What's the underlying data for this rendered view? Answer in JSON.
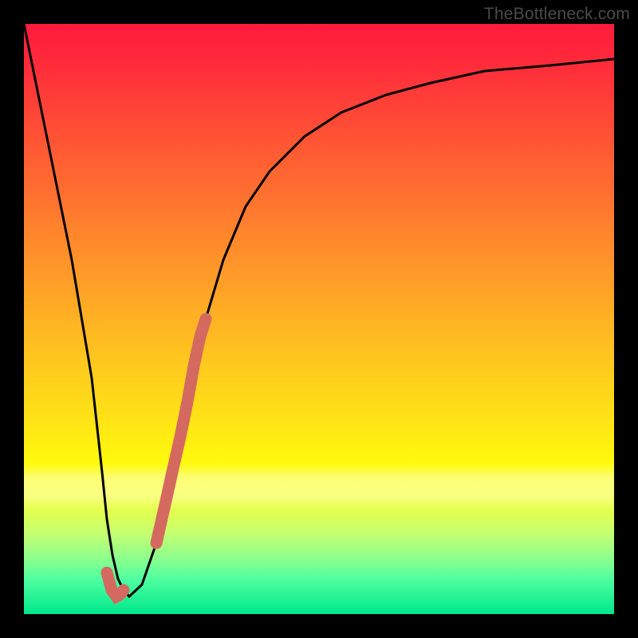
{
  "watermark": "TheBottleneck.com",
  "chart_data": {
    "type": "line",
    "title": "",
    "xlabel": "",
    "ylabel": "",
    "xlim": [
      0,
      100
    ],
    "ylim": [
      0,
      100
    ],
    "grid": false,
    "legend": false,
    "series": [
      {
        "name": "bottleneck-curve",
        "x": [
          0,
          3,
          6,
          9,
          11,
          12,
          13,
          14,
          15,
          16,
          18,
          20,
          22,
          24,
          27,
          30,
          34,
          38,
          44,
          50,
          58,
          66,
          76,
          88,
          100
        ],
        "values": [
          100,
          80,
          60,
          40,
          24,
          16,
          10,
          6,
          4,
          3,
          5,
          12,
          24,
          36,
          50,
          60,
          69,
          75,
          81,
          85,
          88,
          90,
          92,
          93,
          94
        ]
      }
    ],
    "annotations": [
      {
        "name": "highlight-segment",
        "x": [
          20,
          21,
          22,
          23,
          24,
          25,
          26,
          27
        ],
        "values": [
          12,
          18,
          24,
          30,
          36,
          42,
          47,
          50
        ],
        "color": "#d46a5f",
        "width": 14
      },
      {
        "name": "highlight-hook",
        "x": [
          12.0,
          12.8,
          13.5,
          14.2,
          15.0
        ],
        "values": [
          7.0,
          4.0,
          3.0,
          3.4,
          4.0
        ],
        "color": "#d46a5f",
        "width": 14
      }
    ],
    "background_gradient": {
      "top": "#ff1a3c",
      "mid": "#ffe316",
      "bottom": "#00e78c"
    },
    "highlight_band_y": [
      18,
      26
    ]
  }
}
